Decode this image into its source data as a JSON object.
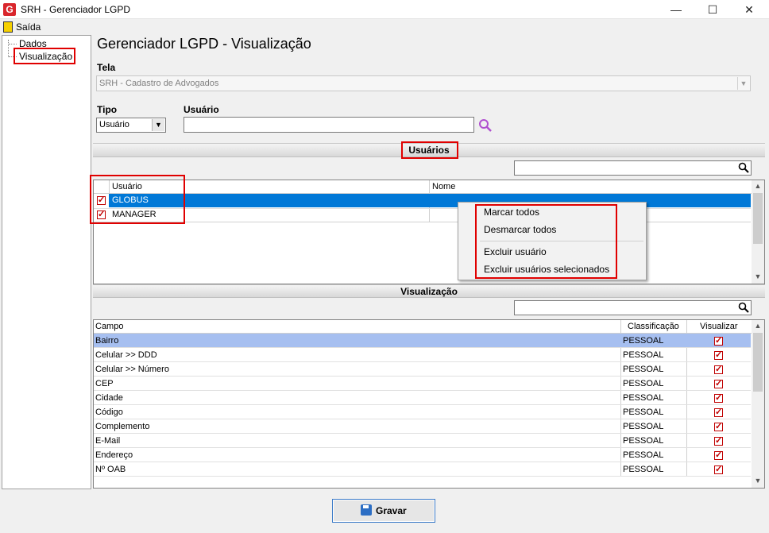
{
  "window": {
    "title": "SRH - Gerenciador LGPD",
    "app_icon_letter": "G",
    "controls": {
      "minimize": "—",
      "maximize": "☐",
      "close": "✕"
    }
  },
  "menu": {
    "exit_label": "Saída"
  },
  "tree": {
    "items": [
      "Dados",
      "Visualização"
    ]
  },
  "page_title": "Gerenciador LGPD - Visualização",
  "form": {
    "tela_label": "Tela",
    "tela_value": "SRH - Cadastro de Advogados",
    "tipo_label": "Tipo",
    "tipo_value": "Usuário",
    "usuario_label": "Usuário",
    "usuario_value": ""
  },
  "users_section": {
    "title": "Usuários",
    "search_value": "",
    "columns": [
      "Usuário",
      "Nome"
    ],
    "rows": [
      {
        "usuario": "GLOBUS",
        "nome": "",
        "checked": true,
        "selected": true
      },
      {
        "usuario": "MANAGER",
        "nome": "",
        "checked": true,
        "selected": false
      }
    ]
  },
  "context_menu": {
    "items": [
      "Marcar todos",
      "Desmarcar todos",
      "Excluir usuário",
      "Excluir usuários selecionados"
    ]
  },
  "view_section": {
    "title": "Visualização",
    "search_value": "",
    "columns": [
      "Campo",
      "Classificação",
      "Visualizar"
    ],
    "rows": [
      {
        "campo": "Bairro",
        "classificacao": "PESSOAL",
        "visualizar": true,
        "selected": true
      },
      {
        "campo": "Celular >> DDD",
        "classificacao": "PESSOAL",
        "visualizar": true
      },
      {
        "campo": "Celular >> Número",
        "classificacao": "PESSOAL",
        "visualizar": true
      },
      {
        "campo": "CEP",
        "classificacao": "PESSOAL",
        "visualizar": true
      },
      {
        "campo": "Cidade",
        "classificacao": "PESSOAL",
        "visualizar": true
      },
      {
        "campo": "Código",
        "classificacao": "PESSOAL",
        "visualizar": true
      },
      {
        "campo": "Complemento",
        "classificacao": "PESSOAL",
        "visualizar": true
      },
      {
        "campo": "E-Mail",
        "classificacao": "PESSOAL",
        "visualizar": true
      },
      {
        "campo": "Endereço",
        "classificacao": "PESSOAL",
        "visualizar": true
      },
      {
        "campo": "Nº OAB",
        "classificacao": "PESSOAL",
        "visualizar": true
      }
    ]
  },
  "save_button": {
    "label": "Gravar"
  },
  "colors": {
    "selection_blue": "#0078d7",
    "selection_light": "#a6bff0",
    "highlight_red": "#e00000"
  }
}
